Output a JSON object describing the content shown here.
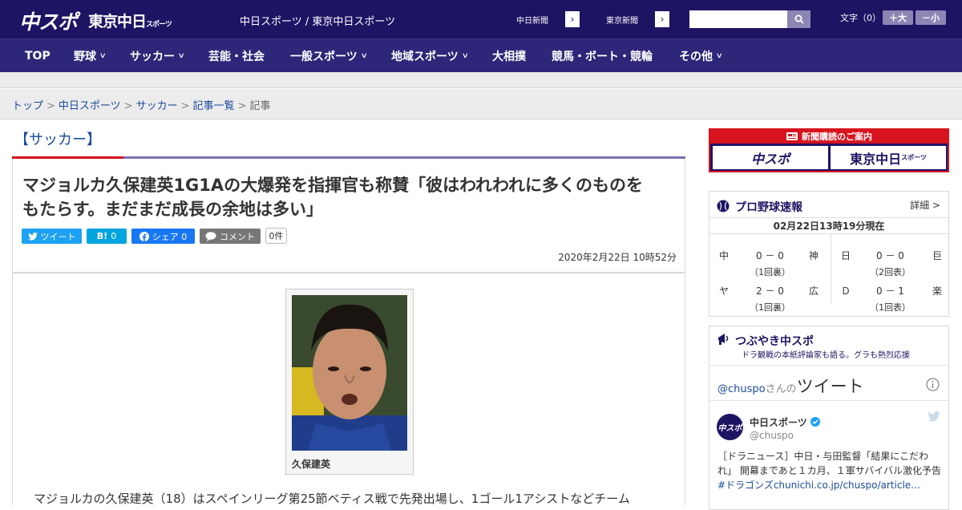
{
  "header": {
    "logo_chuspo": "中スポ",
    "logo_tokyo": "東京中日",
    "logo_tokyo_small": "スポーツ",
    "site_name": "中日スポーツ / 東京中日スポーツ",
    "paper_buttons": [
      {
        "label": "中日新聞"
      },
      {
        "label": "東京新聞"
      }
    ],
    "search": {
      "value": "",
      "placeholder": ""
    },
    "font_size_label": "文字（0）",
    "font_larger": "＋大",
    "font_smaller": "－小"
  },
  "nav": {
    "items": [
      {
        "label": "TOP",
        "has_dropdown": false
      },
      {
        "label": "野球",
        "has_dropdown": true
      },
      {
        "label": "サッカー",
        "has_dropdown": true
      },
      {
        "label": "芸能・社会",
        "has_dropdown": false
      },
      {
        "label": "一般スポーツ",
        "has_dropdown": true
      },
      {
        "label": "地域スポーツ",
        "has_dropdown": true
      },
      {
        "label": "大相撲",
        "has_dropdown": false
      },
      {
        "label": "競馬・ボート・競輪",
        "has_dropdown": false
      },
      {
        "label": "その他",
        "has_dropdown": true
      }
    ]
  },
  "breadcrumb": {
    "items": [
      "トップ",
      "中日スポーツ",
      "サッカー",
      "記事一覧"
    ],
    "current": "記事",
    "separator": ">"
  },
  "article": {
    "category": "【サッカー】",
    "headline_line1": "マジョルカ久保建英1G1Aの大爆発を指揮官も称賛「彼はわれわれに多くのものを",
    "headline_line2": "もたらす。まだまだ成長の余地は多い」",
    "share": {
      "tweet": "ツイート",
      "hatena_icon": "B!",
      "hatena_count": "0",
      "facebook": "シェア 0",
      "comment": "コメント",
      "comment_count": "0件"
    },
    "date": "2020年2月22日 10時52分",
    "photo_caption": "久保建英",
    "lead": "マジョルカの久保建英（18）はスペインリーグ第25節ベティス戦で先発出場し、1ゴール1アシストなどチーム"
  },
  "sidebar": {
    "ad": {
      "title": "新聞購読のご案内",
      "left": "中スポ",
      "right": "東京中日",
      "right_small": "スポーツ"
    },
    "baseball": {
      "title": "プロ野球速報",
      "detail": "詳細 >",
      "date": "02月22日13時19分現在",
      "games": [
        {
          "home": "中",
          "score": "0 － 0",
          "away": "神",
          "inning": "（1回裏）"
        },
        {
          "home": "日",
          "score": "0 － 0",
          "away": "巨",
          "inning": "（2回表）"
        },
        {
          "home": "ヤ",
          "score": "2 － 0",
          "away": "広",
          "inning": "（1回裏）"
        },
        {
          "home": "Ｄ",
          "score": "0 － 1",
          "away": "楽",
          "inning": "（1回表）"
        }
      ]
    },
    "twitter": {
      "title": "つぶやき中スポ",
      "subtitle": "ドラ観戦の本紙評論家も語る。グラも熱烈応援",
      "handle_link": "@chuspo",
      "handle_suffix": "さんの",
      "tweets_label": "ツイート",
      "account_name": "中日スポーツ",
      "account_handle": "@chuspo",
      "tweet_text": "［ドラニュース］中日・与田監督「結果にこだわれ」 開幕まであと１カ月、１軍サバイバル激化予告",
      "tweet_link": "#ドラゴンズchunichi.co.jp/chuspo/article…"
    }
  },
  "colors": {
    "brand": "#1e1464",
    "nav": "#2e2678",
    "accent_red": "#d7141e",
    "link": "#1a4b9b"
  }
}
